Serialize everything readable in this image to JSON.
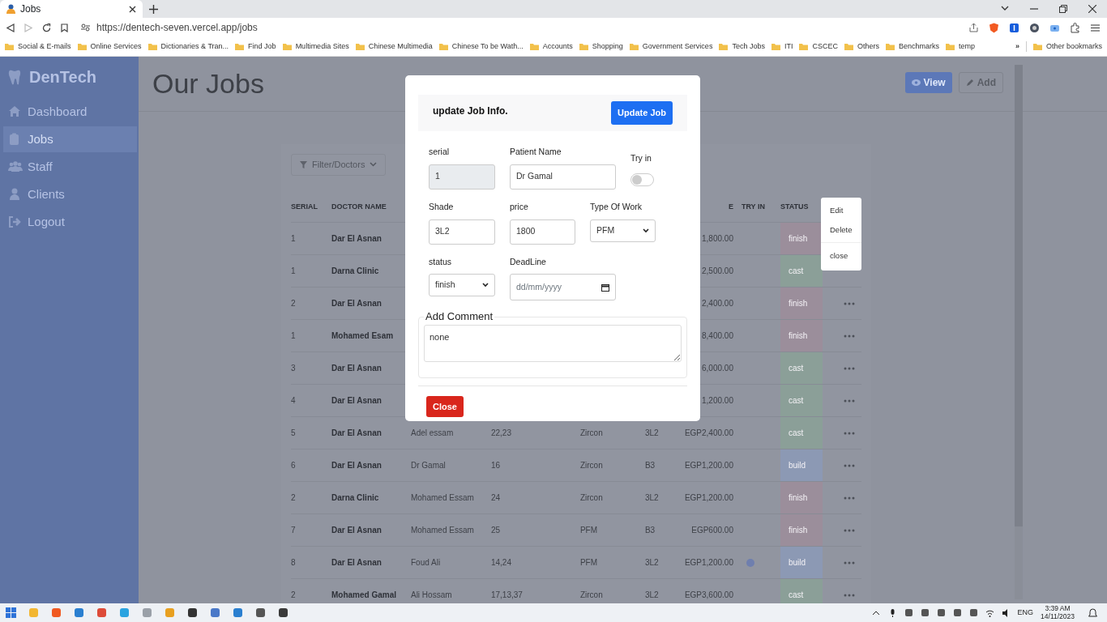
{
  "browser": {
    "tab_title": "Jobs",
    "url": "https://dentech-seven.vercel.app/jobs",
    "bookmarks": [
      "Social & E-mails",
      "Online Services",
      "Dictionaries & Tran...",
      "Find Job",
      "Multimedia Sites",
      "Chinese Multimedia",
      "Chinese To be Wath...",
      "Accounts",
      "Shopping",
      "Government Services",
      "Tech Jobs",
      "ITI",
      "CSCEC",
      "Others",
      "Benchmarks",
      "temp"
    ],
    "more_bookmarks": "»",
    "other_bookmarks": "Other bookmarks"
  },
  "sidebar": {
    "brand": "DenTech",
    "items": [
      {
        "label": "Dashboard",
        "selected": false
      },
      {
        "label": "Jobs",
        "selected": true
      },
      {
        "label": "Staff",
        "selected": false
      },
      {
        "label": "Clients",
        "selected": false
      },
      {
        "label": "Logout",
        "selected": false
      }
    ]
  },
  "page": {
    "title": "Our Jobs",
    "buttons": [
      "View",
      "Add"
    ],
    "filter_button": "Filter/Doctors"
  },
  "table": {
    "columns": [
      "SERIAL",
      "DOCTOR NAME",
      null,
      null,
      null,
      null,
      "E",
      "TRY IN",
      "STATUS"
    ],
    "rows": [
      {
        "serial": "1",
        "doctor": "Dar El Asnan",
        "price": "1,800.00",
        "try_in": false,
        "status": "finish",
        "color": "#9b8e9b",
        "menu_button": false
      },
      {
        "serial": "1",
        "doctor": "Darna Clinic",
        "price": "2,500.00",
        "try_in": false,
        "status": "cast",
        "color": "#8b9f98",
        "menu_button": false
      },
      {
        "serial": "2",
        "doctor": "Dar El Asnan",
        "price": "2,400.00",
        "try_in": false,
        "status": "finish",
        "color": "#9b8e9b",
        "menu_button": true
      },
      {
        "serial": "1",
        "doctor": "Mohamed Esam",
        "price": "8,400.00",
        "try_in": false,
        "status": "finish",
        "color": "#9b8e9b",
        "menu_button": true
      },
      {
        "serial": "3",
        "doctor": "Dar El Asnan",
        "price": "6,000.00",
        "try_in": false,
        "status": "cast",
        "color": "#8b9f98",
        "menu_button": true
      },
      {
        "serial": "4",
        "doctor": "Dar El Asnan",
        "price": "1,200.00",
        "try_in": false,
        "status": "cast",
        "color": "#8b9f98",
        "menu_button": true
      },
      {
        "serial": "5",
        "doctor": "Dar El Asnan",
        "patient": "Adel essam",
        "teeth": "22,23",
        "type": "Zircon",
        "shade": "3L2",
        "price": "EGP2,400.00",
        "try_in": false,
        "status": "cast",
        "color": "#8b9f98",
        "menu_button": true
      },
      {
        "serial": "6",
        "doctor": "Dar El Asnan",
        "patient": "Dr Gamal",
        "teeth": "16",
        "type": "Zircon",
        "shade": "B3",
        "price": "EGP1,200.00",
        "try_in": false,
        "status": "build",
        "color": "#8c99b4",
        "menu_button": true
      },
      {
        "serial": "2",
        "doctor": "Darna Clinic",
        "patient": "Mohamed Essam",
        "teeth": "24",
        "type": "Zircon",
        "shade": "3L2",
        "price": "EGP1,200.00",
        "try_in": false,
        "status": "finish",
        "color": "#9b8e9b",
        "menu_button": true
      },
      {
        "serial": "7",
        "doctor": "Dar El Asnan",
        "patient": "Mohamed Essam",
        "teeth": "25",
        "type": "PFM",
        "shade": "B3",
        "price": "EGP600.00",
        "try_in": false,
        "status": "finish",
        "color": "#9b8e9b",
        "menu_button": true
      },
      {
        "serial": "8",
        "doctor": "Dar El Asnan",
        "patient": "Foud Ali",
        "teeth": "14,24",
        "type": "PFM",
        "shade": "3L2",
        "price": "EGP1,200.00",
        "try_in": true,
        "status": "build",
        "color": "#8c99b4",
        "menu_button": true
      },
      {
        "serial": "2",
        "doctor": "Mohamed Gamal",
        "patient": "Ali Hossam",
        "teeth": "17,13,37",
        "type": "Zircon",
        "shade": "3L2",
        "price": "EGP3,600.00",
        "try_in": false,
        "status": "cast",
        "color": "#8b9f98",
        "menu_button": true
      }
    ]
  },
  "row_menu": {
    "items": [
      {
        "label": "Edit",
        "divider_before": false
      },
      {
        "label": "Delete",
        "divider_before": false
      },
      {
        "label": "close",
        "divider_before": true
      }
    ]
  },
  "modal": {
    "title": "update Job Info.",
    "submit_button": "Update Job",
    "form_rows": [
      [
        {
          "kind": "text",
          "label": "serial",
          "value": "1",
          "disabled": true
        },
        {
          "kind": "text",
          "label": "Patient Name",
          "value": "Dr Gamal",
          "disabled": false
        },
        {
          "kind": "switch",
          "label": "Try in",
          "on": false
        }
      ],
      [
        {
          "kind": "text",
          "label": "Shade",
          "value": "3L2",
          "disabled": false
        },
        {
          "kind": "text",
          "label": "price",
          "value": "1800",
          "disabled": false
        },
        {
          "kind": "select",
          "label": "Type Of Work",
          "value": "PFM"
        }
      ],
      [
        {
          "kind": "select",
          "label": "status",
          "value": "finish"
        },
        {
          "kind": "date",
          "label": "DeadLine",
          "placeholder": "dd/mm/yyyy"
        }
      ]
    ],
    "comment": {
      "legend": "Add Comment",
      "value": "none"
    },
    "close_button": "Close"
  },
  "taskbar": {
    "language": "ENG",
    "time": "3:39 AM",
    "date": "14/11/2023"
  }
}
